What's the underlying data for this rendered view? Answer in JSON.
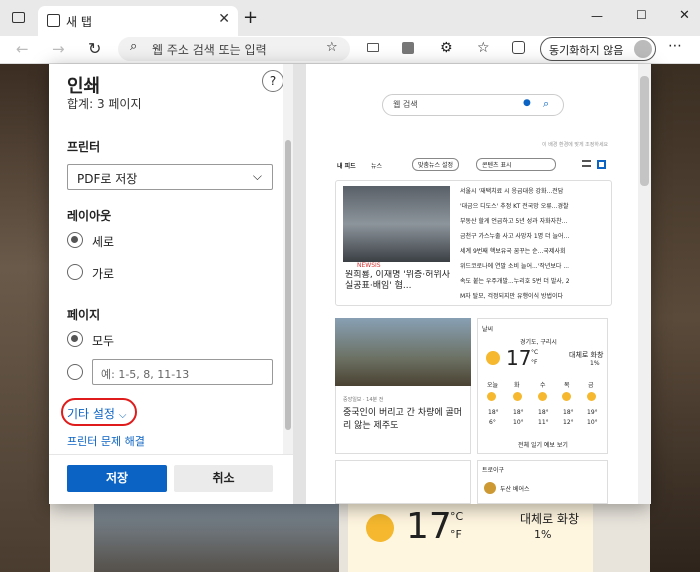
{
  "browser": {
    "tab_title": "새 탭",
    "tab_close": "✕",
    "new_tab": "+",
    "address_placeholder": "웹 주소 검색 또는 입력",
    "sync_label": "동기화하지 않음",
    "window_controls": [
      "—",
      "☐",
      "✕"
    ]
  },
  "print": {
    "title": "인쇄",
    "subtitle": "합계: 3 페이지",
    "help": "?",
    "printer_label": "프린터",
    "printer_value": "PDF로 저장",
    "layout_label": "레이아웃",
    "layout_options": [
      "세로",
      "가로"
    ],
    "layout_selected": 0,
    "pages_label": "페이지",
    "pages_options": [
      "모두"
    ],
    "pages_placeholder": "예: 1-5, 8, 11-13",
    "more_settings": "기타 설정",
    "trouble": "프린터 문제 해결",
    "save": "저장",
    "cancel": "취소"
  },
  "preview": {
    "search_placeholder": "웹 검색",
    "feed_note": "이 배경 환경에 맞게 조정하세요",
    "feed_tabs": [
      "내 피드",
      "뉴스"
    ],
    "custom_btn": "맞춤뉴스 설정",
    "content_btn": "콘텐츠 표시",
    "headlines": [
      "서울시 '재택치료 시 응급대응 강화...전담",
      "'대금으 디도스' 추정 KT 전국망 오류...경찰",
      "부동산 할게 언급하고 5년 성과 자화자찬...",
      "금천구 가스누출 사고 사망자 1명 더 늘어...",
      "세계 9번째 핵보유국 꿈꾸는 순...국제사회",
      "위드코로나에 연말 소비 늘어...'작년보다 ...",
      "속도 붙는 우주개발...누리호 5번 더 발사, 2",
      "M자 탈모, 걱정되지만 유행이식 방법이다"
    ],
    "main_headline": "원희룡, 이재명 '위증·허위사실공표·배임' 혐...",
    "photo_tag": "NEWSIS",
    "story2_source": "중앙일보 · 14분 전",
    "story2": "중국인이 버리고 간 차량에 골머리 앓는 제주도",
    "weather_title": "날씨",
    "weather_loc": "경기도, 구리시",
    "weather_temp": "17",
    "weather_unit": "°C",
    "weather_unit_f": "°F",
    "weather_desc": "대체로 화창",
    "weather_rain": "1%",
    "forecast_days": [
      "오늘",
      "화",
      "수",
      "목",
      "금"
    ],
    "forecast_high": [
      "18°",
      "18°",
      "18°",
      "18°",
      "19°"
    ],
    "forecast_low": [
      "6°",
      "10°",
      "11°",
      "12°",
      "10°"
    ],
    "forecast_link": "전체 일기 예보 보기",
    "card3_title": "트로이구",
    "card4_item": "두산 베어스"
  },
  "background": {
    "temp": "17",
    "unit_c": "°C",
    "unit_f": "°F",
    "desc": "대체로 화창",
    "rain": "1%"
  }
}
